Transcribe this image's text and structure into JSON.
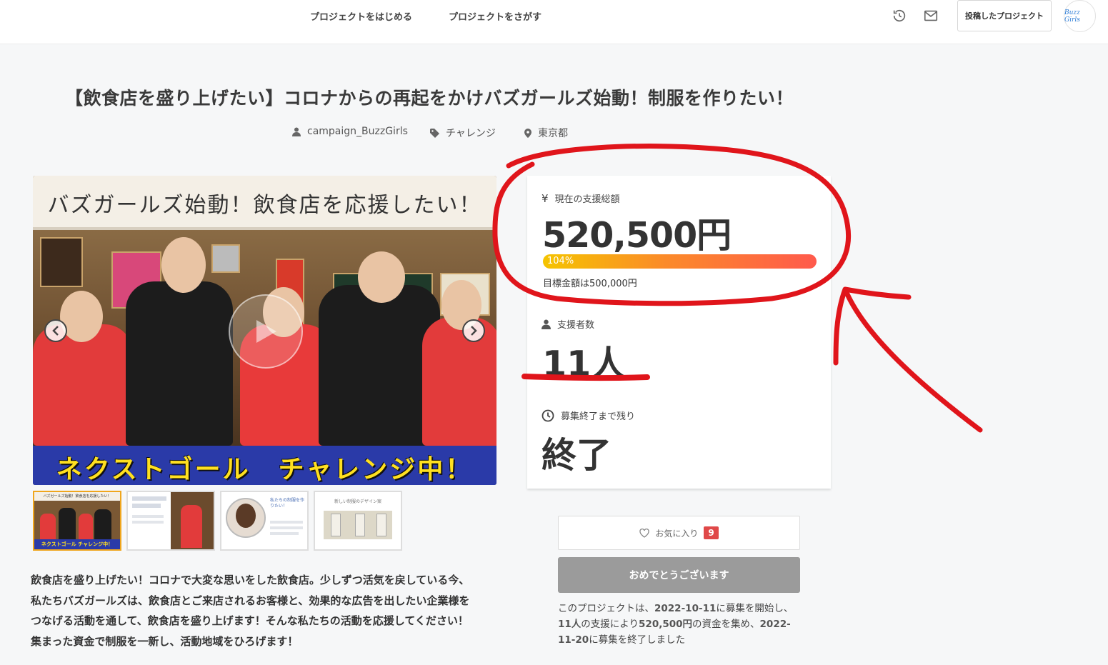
{
  "nav": {
    "start_label": "プロジェクトをはじめる",
    "search_label": "プロジェクトをさがす",
    "history_icon": "history-icon",
    "mail_icon": "mail-icon",
    "posted_label": "投稿したプロジェクト",
    "avatar_text": "Buzz Girls"
  },
  "project": {
    "title": "【飲食店を盛り上げたい】コロナからの再起をかけバズガールズ始動！制服を作りたい！",
    "owner": "campaign_BuzzGirls",
    "category": "チャレンジ",
    "location": "東京都"
  },
  "hero": {
    "top_caption": "バズガールズ始動！飲食店を応援したい！",
    "bottom_caption": "ネクストゴール　チャレンジ中！",
    "thumb1_top": "バズガールズ始動！飲食店を応援したい！",
    "thumb1_bottom": "ネクストゴール チャレンジ中！",
    "thumb3_title": "私たちの制服を作りたい！",
    "thumb4_title": "新しい制服のデザイン案"
  },
  "description": [
    "飲食店を盛り上げたい！コロナで大変な思いをした飲食店。少しずつ活気を戻している今、",
    "私たちバズガールズは、飲食店とご来店されるお客様と、効果的な広告を出したい企業様を",
    "つなげる活動を通して、飲食店を盛り上げます！そんな私たちの活動を応援してください！",
    "集まった資金で制服を一新し、活動地域をひろげます！"
  ],
  "stats": {
    "currency_icon": "¥",
    "amount_label": "現在の支援総額",
    "amount": "520,500円",
    "progress_label": "104%",
    "progress_value": 1.04,
    "goal": "目標金額は500,000円",
    "backers_label": "支援者数",
    "backers": "11人",
    "remaining_label": "募集終了まで残り",
    "remaining": "終了"
  },
  "actions": {
    "favorite_label": "お気に入り",
    "favorite_count": "9",
    "done_label": "おめでとうございます"
  },
  "summary": {
    "p1": "このプロジェクトは、",
    "start_date": "2022-10-11",
    "p2": "に募集を開始し、",
    "backers": "11人",
    "p3": "の支援により",
    "amount": "520,500円",
    "p4": "の資金を集め、",
    "end_date": "2022-11-20",
    "p5": "に募集を終了しました"
  },
  "colors": {
    "annotation": "#e0151b",
    "progress_start": "#f5c400",
    "progress_end": "#ff5a4c",
    "badge": "#e04848"
  }
}
